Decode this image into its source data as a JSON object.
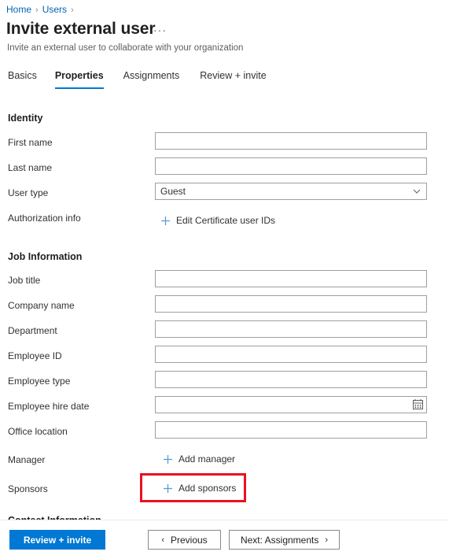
{
  "breadcrumb": {
    "items": [
      {
        "label": "Home"
      },
      {
        "label": "Users"
      }
    ],
    "separator": "›"
  },
  "header": {
    "title": "Invite external user",
    "ellipsis": "···",
    "subtitle": "Invite an external user to collaborate with your organization"
  },
  "tabs": [
    {
      "label": "Basics",
      "active": false
    },
    {
      "label": "Properties",
      "active": true
    },
    {
      "label": "Assignments",
      "active": false
    },
    {
      "label": "Review + invite",
      "active": false
    }
  ],
  "sections": {
    "identity": {
      "heading": "Identity",
      "rows": {
        "first_name": {
          "label": "First name",
          "value": "",
          "placeholder": ""
        },
        "last_name": {
          "label": "Last name",
          "value": "",
          "placeholder": ""
        },
        "user_type": {
          "label": "User type",
          "value": "Guest",
          "icon": "chevron-down-icon"
        },
        "authorization_info": {
          "label": "Authorization info",
          "action": "Edit Certificate user IDs",
          "icon": "plus-icon"
        }
      }
    },
    "job_information": {
      "heading": "Job Information",
      "rows": {
        "job_title": {
          "label": "Job title",
          "value": "",
          "placeholder": ""
        },
        "company_name": {
          "label": "Company name",
          "value": "",
          "placeholder": ""
        },
        "department": {
          "label": "Department",
          "value": "",
          "placeholder": ""
        },
        "employee_id": {
          "label": "Employee ID",
          "value": "",
          "placeholder": ""
        },
        "employee_type": {
          "label": "Employee type",
          "value": "",
          "placeholder": ""
        },
        "employee_hire_date": {
          "label": "Employee hire date",
          "value": "",
          "placeholder": "",
          "icon": "calendar-icon"
        },
        "office_location": {
          "label": "Office location",
          "value": "",
          "placeholder": ""
        },
        "manager": {
          "label": "Manager",
          "action": "Add manager",
          "icon": "plus-icon"
        },
        "sponsors": {
          "label": "Sponsors",
          "action": "Add sponsors",
          "icon": "plus-icon",
          "highlighted": true
        }
      }
    },
    "contact_information": {
      "heading": "Contact Information"
    }
  },
  "footer": {
    "review_invite": "Review + invite",
    "previous": "Previous",
    "previous_icon": "‹",
    "next": "Next: Assignments",
    "next_icon": "›"
  },
  "colors": {
    "accent": "#0078d4",
    "link": "#0063b1",
    "highlight": "#e81123",
    "border": "#a19f9d",
    "text": "#323130"
  }
}
